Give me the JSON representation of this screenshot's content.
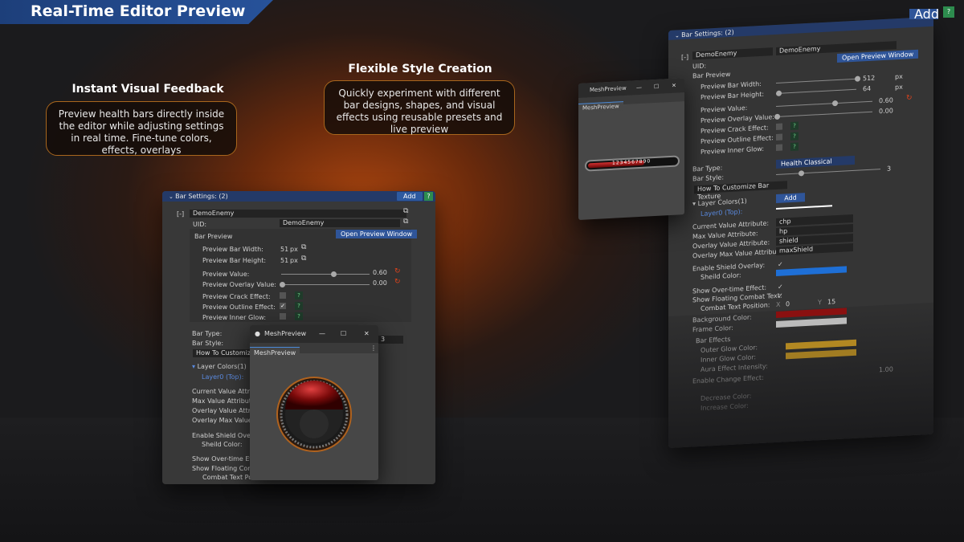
{
  "banner": {
    "title": "Real-Time Editor Preview"
  },
  "feature_left": {
    "title": "Instant Visual Feedback",
    "text": "Preview health bars directly inside the editor while adjusting settings in real time. Fine-tune colors, effects, overlays"
  },
  "feature_mid": {
    "title": "Flexible Style Creation",
    "text": "Quickly experiment with different bar designs, shapes, and visual effects using reusable presets and live preview"
  },
  "left_panel": {
    "header": "Bar Settings: (2)",
    "add": "Add",
    "help": "?",
    "collapse": "[-]",
    "name": "DemoEnemy",
    "uid_label": "UID:",
    "uid_value": "DemoEnemy",
    "bar_preview": "Bar Preview",
    "open_preview": "Open Preview Window",
    "width_label": "Preview Bar Width:",
    "width_value": "51",
    "height_label": "Preview Bar Height:",
    "height_value": "51",
    "px": "px",
    "value_label": "Preview Value:",
    "value": "0.60",
    "overlay_label": "Preview Overlay Value:",
    "overlay": "0.00",
    "crack_label": "Preview Crack Effect:",
    "outline_label": "Preview Outline Effect:",
    "glow_label": "Preview Inner Glow:",
    "bar_type": "Bar Type:",
    "bar_style": "Bar Style:",
    "style_value": "3",
    "customize": "How To Customiz",
    "layer_colors": "Layer Colors(1)",
    "layer0": "Layer0 (Top):",
    "current_attr": "Current Value Attrib",
    "max_attr": "Max Value Attribute",
    "overlay_attr": "Overlay Value Attrib",
    "overlay_max_attr": "Overlay Max Value A",
    "shield_overlay": "Enable Shield Overla",
    "shield_color": "Sheild Color:",
    "overtime": "Show Over-time Effe",
    "floating": "Show Floating Comb",
    "combat_pos": "Combat Text Po"
  },
  "mesh_window": {
    "title": "MeshPreview",
    "tab": "MeshPreview",
    "menu": "⋮",
    "minimize": "—",
    "maximize": "☐",
    "close": "✕"
  },
  "right_panel": {
    "add_top": "Add",
    "help_top": "?",
    "header": "Bar Settings: (2)",
    "collapse": "[-]",
    "name": "DemoEnemy",
    "name_value": "DemoEnemy",
    "uid_label": "UID:",
    "open_preview": "Open Preview Window",
    "bar_preview": "Bar Preview",
    "width_label": "Preview Bar Width:",
    "width_value": "512",
    "height_label": "Preview Bar Height:",
    "height_value": "64",
    "px": "px",
    "value_label": "Preview Value:",
    "value": "0.60",
    "overlay_label": "Preview Overlay Value:",
    "overlay": "0.00",
    "crack_label": "Preview Crack Effect:",
    "outline_label": "Preview Outline Effect:",
    "glow_label": "Preview Inner Glow:",
    "bar_type": "Bar Type:",
    "bar_type_value": "Health Classical",
    "bar_style": "Bar Style:",
    "style_value": "3",
    "customize": "How To Customize Bar Texture",
    "layer_colors": "Layer Colors(1)",
    "add": "Add",
    "layer0": "Layer0 (Top):",
    "current_attr": "Current Value Attribute:",
    "current_attr_value": "chp",
    "max_attr": "Max Value Attribute:",
    "max_attr_value": "hp",
    "overlay_attr": "Overlay Value Attribute:",
    "overlay_attr_value": "shield",
    "overlay_max_attr": "Overlay Max Value Attribute:",
    "overlay_max_attr_value": "maxShield",
    "shield_overlay": "Enable Shield Overlay:",
    "shield_color": "Sheild Color:",
    "overtime": "Show Over-time Effect:",
    "floating": "Show Floating Combat Text:",
    "combat_pos": "Combat Text Position:",
    "pos_x_label": "X",
    "pos_x": "0",
    "pos_y_label": "Y",
    "pos_y": "15",
    "bg_color": "Background Color:",
    "frame_color": "Frame Color:",
    "bar_effects": "Bar Effects",
    "outer_glow": "Outer Glow Color:",
    "inner_glow": "Inner Glow Color:",
    "aura": "Aura Effect Intensity:",
    "aura_value": "1.00",
    "change_effect": "Enable Change Effect:",
    "decrease": "Decrease Color:",
    "increase": "Increase Color:"
  },
  "right_mesh_window": {
    "title": "MeshPreview",
    "tab": "MeshPreview",
    "bar_number": "1234567890"
  },
  "colors": {
    "accent": "#2f5599",
    "help_green": "#2d8c4e",
    "reset": "#e0431b",
    "shield_blue": "#1e6fd6",
    "glow_yellow": "#d4a020",
    "bar_red": "#8a1010"
  }
}
